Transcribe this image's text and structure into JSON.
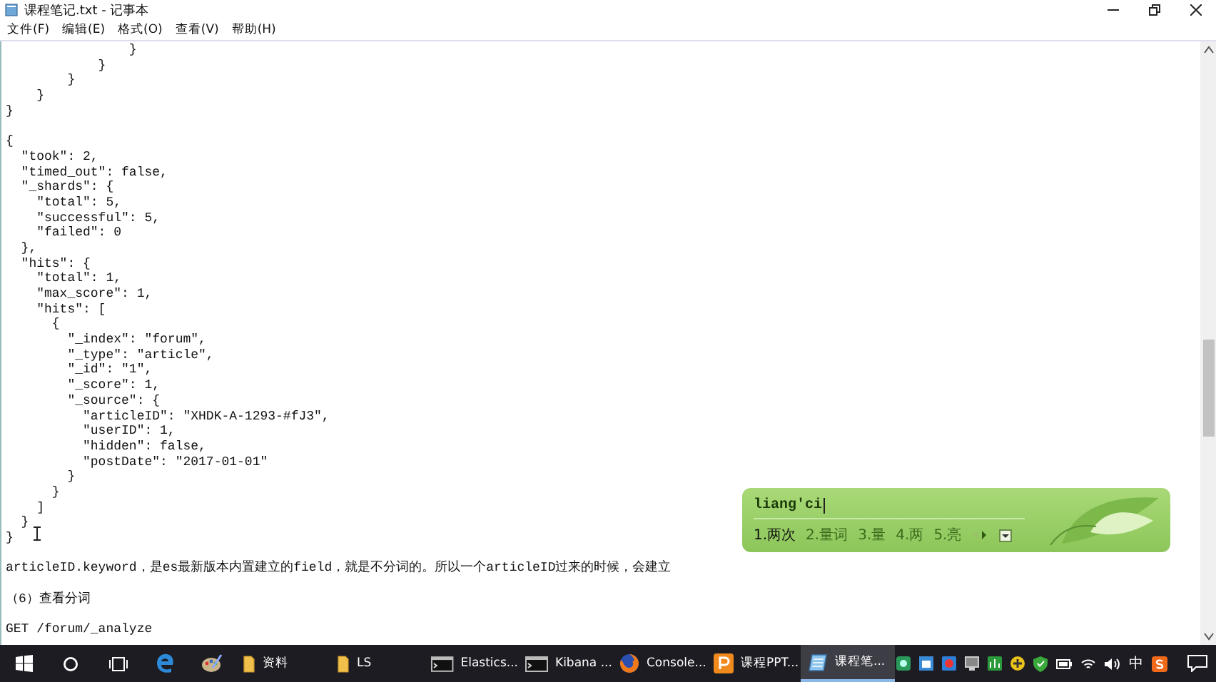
{
  "window": {
    "title": "课程笔记.txt - 记事本",
    "menu": [
      "文件(F)",
      "编辑(E)",
      "格式(O)",
      "查看(V)",
      "帮助(H)"
    ]
  },
  "document": {
    "blocks": [
      {
        "lines": [
          "                }",
          "            }",
          "        }",
          "    }",
          "}"
        ]
      },
      {
        "lines": [
          "{",
          "  \"took\": 2,",
          "  \"timed_out\": false,",
          "  \"_shards\": {",
          "    \"total\": 5,",
          "    \"successful\": 5,",
          "    \"failed\": 0",
          "  },",
          "  \"hits\": {",
          "    \"total\": 1,",
          "    \"max_score\": 1,",
          "    \"hits\": [",
          "      {",
          "        \"_index\": \"forum\",",
          "        \"_type\": \"article\",",
          "        \"_id\": \"1\",",
          "        \"_score\": 1,",
          "        \"_source\": {",
          "          \"articleID\": \"XHDK-A-1293-#fJ3\",",
          "          \"userID\": 1,",
          "          \"hidden\": false,",
          "          \"postDate\": \"2017-01-01\"",
          "        }",
          "      }",
          "    ]",
          "  }",
          "}"
        ]
      },
      {
        "lines": [
          "articleID.keyword，是es最新版本内置建立的field，就是不分词的。所以一个articleID过来的时候，会建立"
        ]
      },
      {
        "lines": [
          "（6）查看分词"
        ]
      },
      {
        "lines": [
          "GET /forum/_analyze"
        ]
      }
    ]
  },
  "ime": {
    "input": "liang'ci",
    "candidates": [
      {
        "label": "1.两次",
        "selected": true
      },
      {
        "label": "2.量词",
        "selected": false
      },
      {
        "label": "3.量",
        "selected": false
      },
      {
        "label": "4.两",
        "selected": false
      },
      {
        "label": "5.亮",
        "selected": false
      }
    ]
  },
  "taskbar": {
    "items": [
      {
        "kind": "start",
        "selected": false
      },
      {
        "kind": "search",
        "selected": false
      },
      {
        "kind": "task-view",
        "selected": false
      },
      {
        "kind": "browser",
        "selected": false
      },
      {
        "kind": "paint",
        "selected": false
      },
      {
        "kind": "folder",
        "label": "资料",
        "selected": false
      },
      {
        "kind": "folder",
        "label": "LS",
        "selected": false
      },
      {
        "kind": "terminal",
        "label": "Elastics...",
        "selected": false
      },
      {
        "kind": "terminal",
        "label": "Kibana ...",
        "selected": false
      },
      {
        "kind": "firefox",
        "label": "Console...",
        "selected": false
      },
      {
        "kind": "slides",
        "label": "课程PPT...",
        "selected": false
      },
      {
        "kind": "notepad",
        "label": "课程笔...",
        "selected": true
      }
    ],
    "input_method": "中"
  }
}
